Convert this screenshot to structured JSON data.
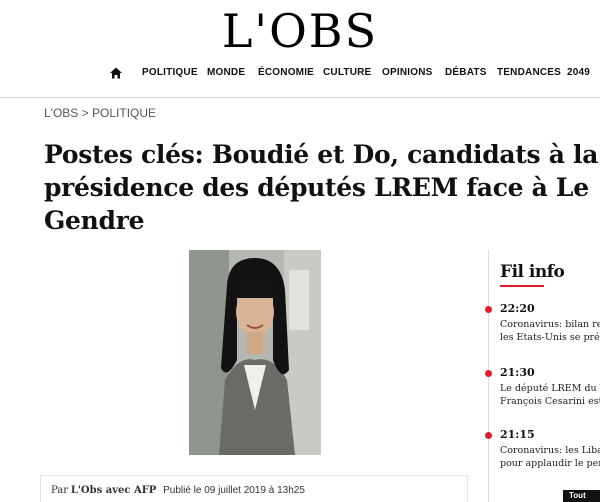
{
  "brand": {
    "logo": "L'OBS"
  },
  "nav": {
    "items": [
      {
        "label": "POLITIQUE"
      },
      {
        "label": "MONDE"
      },
      {
        "label": "ÉCONOMIE"
      },
      {
        "label": "CULTURE"
      },
      {
        "label": "OPINIONS"
      },
      {
        "label": "DÉBATS"
      },
      {
        "label": "TENDANCES"
      },
      {
        "label": "2049"
      }
    ]
  },
  "breadcrumb": {
    "root": "L'OBS",
    "sep": ">",
    "section": "POLITIQUE"
  },
  "article": {
    "title": "Postes clés: Boudié et Do, candidats à la présidence des députés LREM face à Le Gendre",
    "byline_prefix": "Par",
    "author": "L'Obs avec AFP",
    "published": "Publié le 09 juillet 2019 à 13h25"
  },
  "fil_info": {
    "title": "Fil info",
    "items": [
      {
        "time": "22:20",
        "line1": "Coronavirus: bilan rec",
        "line2": "les Etats-Unis se prépa"
      },
      {
        "time": "21:30",
        "line1": "Le député LREM du Va",
        "line2": "François Cesarini est d"
      },
      {
        "time": "21:15",
        "line1": "Coronavirus: les Liban",
        "line2": "pour applaudir le person"
      }
    ]
  },
  "corner_button": {
    "label": "Tout"
  },
  "colors": {
    "accent": "#e01e26",
    "text": "#111111"
  }
}
